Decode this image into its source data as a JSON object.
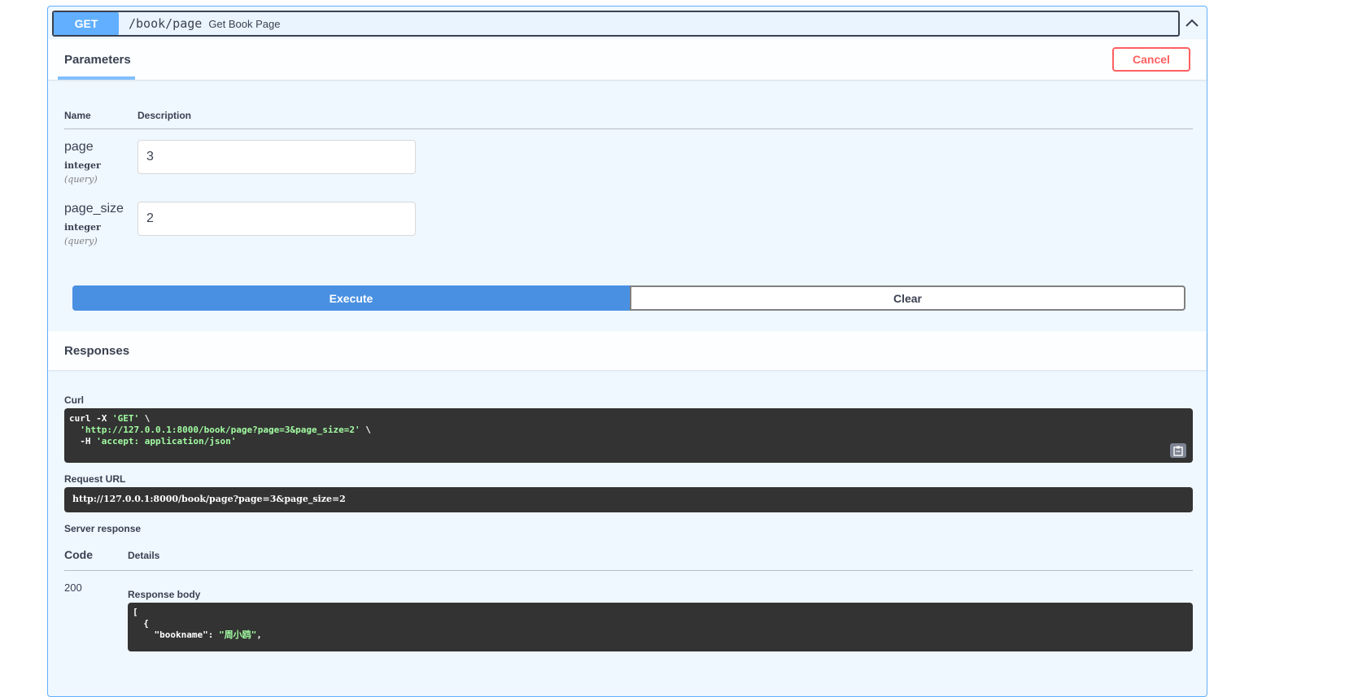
{
  "operation": {
    "method": "GET",
    "path": "/book/page",
    "summary": "Get Book Page"
  },
  "parameters": {
    "tab_label": "Parameters",
    "cancel_label": "Cancel",
    "col_name": "Name",
    "col_description": "Description",
    "items": [
      {
        "name": "page",
        "type": "integer",
        "in": "(query)",
        "value": "3"
      },
      {
        "name": "page_size",
        "type": "integer",
        "in": "(query)",
        "value": "2"
      }
    ],
    "execute_label": "Execute",
    "clear_label": "Clear"
  },
  "responses": {
    "title": "Responses",
    "curl_label": "Curl",
    "curl_lines": [
      {
        "plain": "curl -X ",
        "str": "'GET'",
        "tail": " \\"
      },
      {
        "plain": "  ",
        "str": "'http://127.0.0.1:8000/book/page?page=3&page_size=2'",
        "tail": " \\"
      },
      {
        "plain": "  -H ",
        "str": "'accept: application/json'",
        "tail": ""
      }
    ],
    "request_url_label": "Request URL",
    "request_url": "http://127.0.0.1:8000/book/page?page=3&page_size=2",
    "server_response_label": "Server response",
    "code_header": "Code",
    "details_header": "Details",
    "status_code": "200",
    "response_body_label": "Response body",
    "body_lines": [
      {
        "plain": "[",
        "key": "",
        "str": "",
        "tail": ""
      },
      {
        "plain": "  {",
        "key": "",
        "str": "",
        "tail": ""
      },
      {
        "plain": "    ",
        "key": "\"bookname\"",
        "str": "\"周小鸥\"",
        "tail": ","
      }
    ]
  },
  "colors": {
    "get_blue": "#61affe",
    "execute_blue": "#4990e2",
    "cancel_red": "#ff6060",
    "code_bg": "#333333",
    "string_green": "#a2fca2"
  },
  "icons": {
    "collapse": "chevron-up-icon",
    "copy": "clipboard-icon"
  }
}
